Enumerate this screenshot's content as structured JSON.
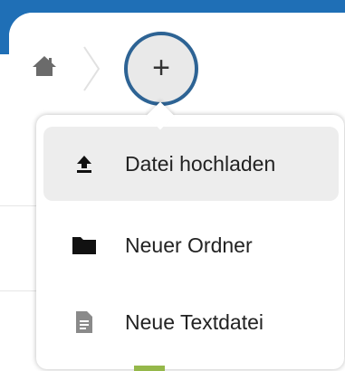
{
  "breadcrumb": {
    "home_icon": "home-icon"
  },
  "new_button": {
    "label": "+",
    "icon": "plus-icon"
  },
  "menu": {
    "items": [
      {
        "label": "Datei hochladen",
        "icon": "upload-icon",
        "active": true
      },
      {
        "label": "Neuer Ordner",
        "icon": "folder-icon",
        "active": false
      },
      {
        "label": "Neue Textdatei",
        "icon": "text-file-icon",
        "active": false
      }
    ]
  },
  "colors": {
    "header_blue": "#1f6fb6",
    "button_ring": "#2d6394",
    "button_fill": "#e9e9e9",
    "hover_row": "#ededed"
  }
}
